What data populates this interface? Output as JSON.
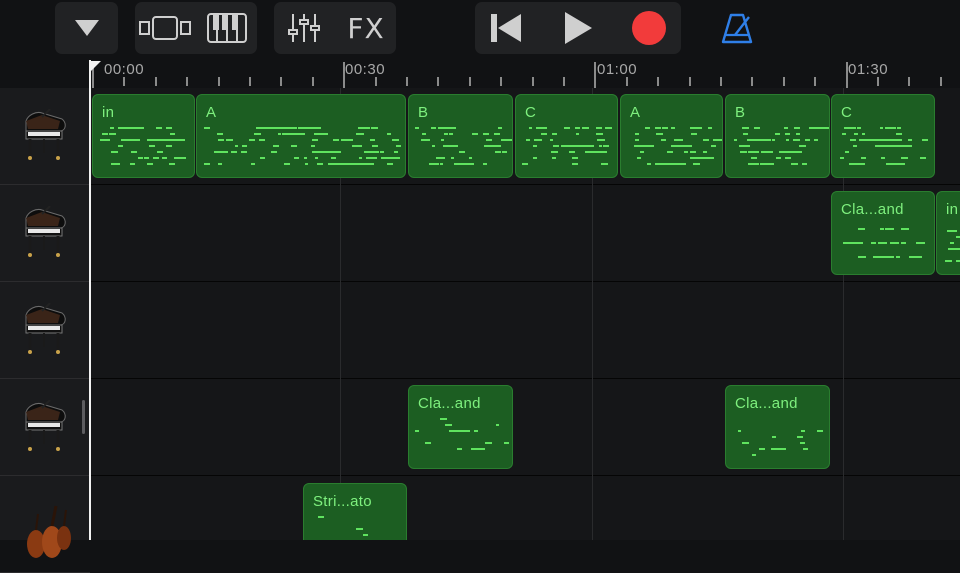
{
  "toolbar": {
    "dropdown_icon": "triangle-down-icon",
    "tracks_view_icon": "tracks-view-icon",
    "keyboard_icon": "piano-keyboard-icon",
    "mixer_icon": "sliders-icon",
    "fx_label": "FX",
    "rewind_icon": "skip-back-icon",
    "play_icon": "play-icon",
    "record_icon": "record-icon",
    "metronome_icon": "metronome-icon",
    "record_color": "#f23b3b",
    "metronome_color": "#2f7fe8"
  },
  "ruler": {
    "labels": [
      "00:00",
      "00:30",
      "01:00",
      "01:30"
    ]
  },
  "tracks": [
    {
      "instrument_icon": "grand-piano-icon"
    },
    {
      "instrument_icon": "grand-piano-icon"
    },
    {
      "instrument_icon": "grand-piano-icon"
    },
    {
      "instrument_icon": "grand-piano-icon"
    },
    {
      "instrument_icon": "strings-icon"
    }
  ],
  "regions": {
    "track1": [
      "in",
      "A",
      "B",
      "C",
      "A",
      "B",
      "C"
    ],
    "track2": [
      "Cla...and",
      "in"
    ],
    "track4": [
      "Cla...and",
      "Cla...and"
    ],
    "track5": [
      "Stri...ato"
    ]
  },
  "colors": {
    "region_fill": "#1c5e22",
    "region_text": "#7ef07e",
    "note": "#5fe35f"
  }
}
